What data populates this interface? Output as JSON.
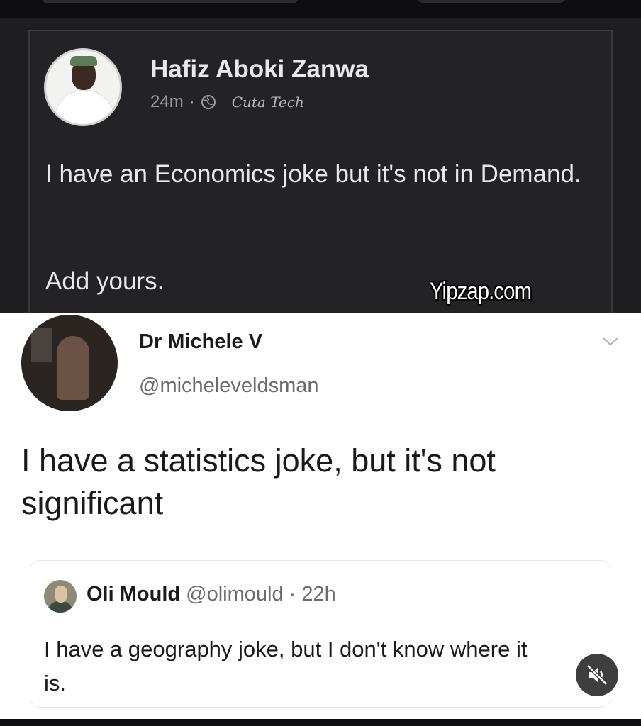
{
  "facebook_post": {
    "author": "Hafiz Aboki Zanwa",
    "time": "24m",
    "separator": "·",
    "signature": "Cuta Tech",
    "text": "I have an Economics joke but it's not in Demand.",
    "text2": "Add yours.",
    "privacy_icon": "globe-icon"
  },
  "watermark": "Yipzap.com",
  "tweet": {
    "author": "Dr Michele V",
    "handle": "@micheleveldsman",
    "text": "I have a statistics joke, but it's not significant",
    "menu_icon": "chevron-down-icon"
  },
  "reply": {
    "author": "Oli Mould",
    "handle": "@olimould",
    "separator": "·",
    "time": "22h",
    "text": "I have a geography joke, but I don't know where it is."
  },
  "mute_icon": "muted-speaker-icon",
  "colors": {
    "dark_bg": "#1e1e21",
    "card_bg": "#232326",
    "light_text": "#e9e9ea",
    "muted_text": "#6b6b6b"
  }
}
